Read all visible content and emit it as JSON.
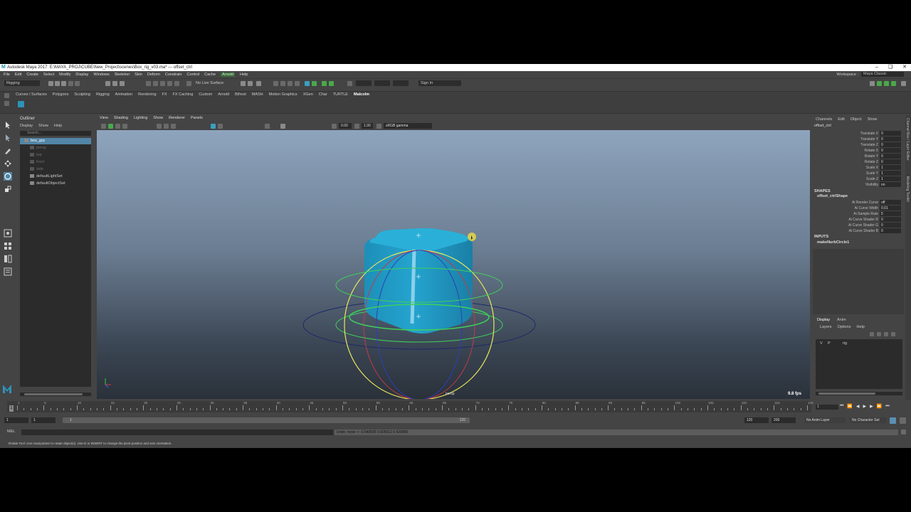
{
  "window": {
    "title": "Autodesk Maya 2017: E:\\MAYA_PROJ\\CUBE\\New_Project\\scenes\\Box_rig_v03.ma*   ---   offset_ctrl",
    "controls": [
      "–",
      "❏",
      "✕"
    ]
  },
  "menubar": [
    "File",
    "Edit",
    "Create",
    "Select",
    "Modify",
    "Display",
    "Windows",
    "Skeleton",
    "Skin",
    "Deform",
    "Constrain",
    "Control",
    "Cache",
    "Arnold",
    "Help"
  ],
  "workspace": {
    "label": "Workspace :",
    "value": "Maya Classic"
  },
  "statusline": {
    "menuset": "Rigging",
    "live_surface": "No Live Surface",
    "sign_in": "Sign In"
  },
  "shelf_tabs": [
    "Curves / Surfaces",
    "Polygons",
    "Sculpting",
    "Rigging",
    "Animation",
    "Rendering",
    "FX",
    "FX Caching",
    "Custom",
    "Arnold",
    "Bifrost",
    "MASH",
    "Motion Graphics",
    "XGen",
    "Char",
    "TURTLE",
    "Malcolm"
  ],
  "outliner": {
    "title": "Outliner",
    "menus": [
      "Display",
      "Show",
      "Help"
    ],
    "search_placeholder": "Search...",
    "items": [
      {
        "label": "box_grp",
        "selected": true,
        "dim": false
      },
      {
        "label": "persp",
        "selected": false,
        "dim": true
      },
      {
        "label": "top",
        "selected": false,
        "dim": true
      },
      {
        "label": "front",
        "selected": false,
        "dim": true
      },
      {
        "label": "side",
        "selected": false,
        "dim": true
      },
      {
        "label": "defaultLightSet",
        "selected": false,
        "dim": false
      },
      {
        "label": "defaultObjectSet",
        "selected": false,
        "dim": false
      }
    ]
  },
  "viewport": {
    "menus": [
      "View",
      "Shading",
      "Lighting",
      "Show",
      "Renderer",
      "Panels"
    ],
    "field1": "0.00",
    "field2": "1.00",
    "colorspace": "sRGB gamma",
    "camera": "persp",
    "fps": "9.8 fps"
  },
  "channelbox": {
    "menus": [
      "Channels",
      "Edit",
      "Object",
      "Show"
    ],
    "object": "offset_ctrl",
    "attributes": [
      {
        "name": "Translate X",
        "value": "0"
      },
      {
        "name": "Translate Y",
        "value": "0"
      },
      {
        "name": "Translate Z",
        "value": "0"
      },
      {
        "name": "Rotate X",
        "value": "0"
      },
      {
        "name": "Rotate Y",
        "value": "0"
      },
      {
        "name": "Rotate Z",
        "value": "0"
      },
      {
        "name": "Scale X",
        "value": "1"
      },
      {
        "name": "Scale Y",
        "value": "1"
      },
      {
        "name": "Scale Z",
        "value": "1"
      },
      {
        "name": "Visibility",
        "value": "on"
      }
    ],
    "shapes_label": "SHAPES",
    "shape_name": "offset_ctrlShape",
    "shape_attributes": [
      {
        "name": "Ai Render Curve",
        "value": "off"
      },
      {
        "name": "Ai Curve Width",
        "value": "0.01"
      },
      {
        "name": "Ai Sample Rate",
        "value": "5"
      },
      {
        "name": "Ai Curve Shader R",
        "value": "0"
      },
      {
        "name": "Ai Curve Shader G",
        "value": "0"
      },
      {
        "name": "Ai Curve Shader B",
        "value": "0"
      }
    ],
    "inputs_label": "INPUTS",
    "input_name": "makeNurbCircle1"
  },
  "side_tabs": [
    "Channel Box / Layer Editor",
    "Modeling Toolkit"
  ],
  "layer_editor": {
    "tabs": [
      "Display",
      "Anim"
    ],
    "menus": [
      "Layers",
      "Options",
      "Help"
    ],
    "layer": {
      "v": "V",
      "p": "P",
      "name": "rig"
    }
  },
  "timeline": {
    "labels": [
      "1",
      "5",
      "10",
      "15",
      "20",
      "25",
      "30",
      "35",
      "40",
      "45",
      "50",
      "55",
      "60",
      "65",
      "70",
      "75",
      "80",
      "85",
      "90",
      "95",
      "100",
      "105",
      "110",
      "115",
      "120"
    ],
    "current_frame": "1",
    "current_field": "1"
  },
  "range": {
    "start": "1",
    "start2": "1",
    "slider_start": "1",
    "slider_end": "120",
    "end": "120",
    "end2": "200",
    "anim_layer": "No Anim Layer",
    "char_set": "No Character Set"
  },
  "cmdline": {
    "label": "MEL",
    "output": "Undo: move -r -0.540505 0.605612 0.429969"
  },
  "helpline": "Rotate Tool: Use manipulator to rotate object(s). Use D or INSERT to change the pivot position and axis orientation."
}
